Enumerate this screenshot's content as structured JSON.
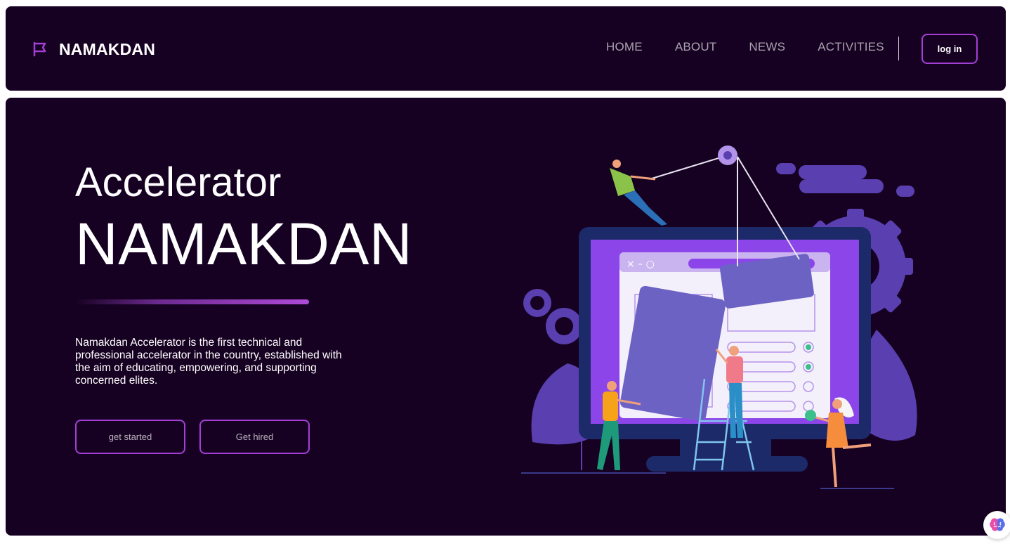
{
  "nav": {
    "brand": "NAMAKDAN",
    "links": [
      "HOME",
      "ABOUT",
      "NEWS",
      "ACTIVITIES"
    ],
    "login_label": "log in"
  },
  "hero": {
    "subtitle": "Accelerator",
    "title": "NAMAKDAN",
    "description": "Namakdan Accelerator is the first technical and professional accelerator in the country, established with the aim of educating, empowering, and supporting concerned elites.",
    "primary_button": "get started",
    "secondary_button": "Get hired"
  },
  "colors": {
    "background": "#170122",
    "accent": "#a43fd6",
    "illustration_primary": "#5a3fb0",
    "illustration_screen": "#8b45e8"
  },
  "icons": {
    "brand": "flag-icon",
    "chat": "brain-icon",
    "illustration": "team-building-website-illustration"
  }
}
